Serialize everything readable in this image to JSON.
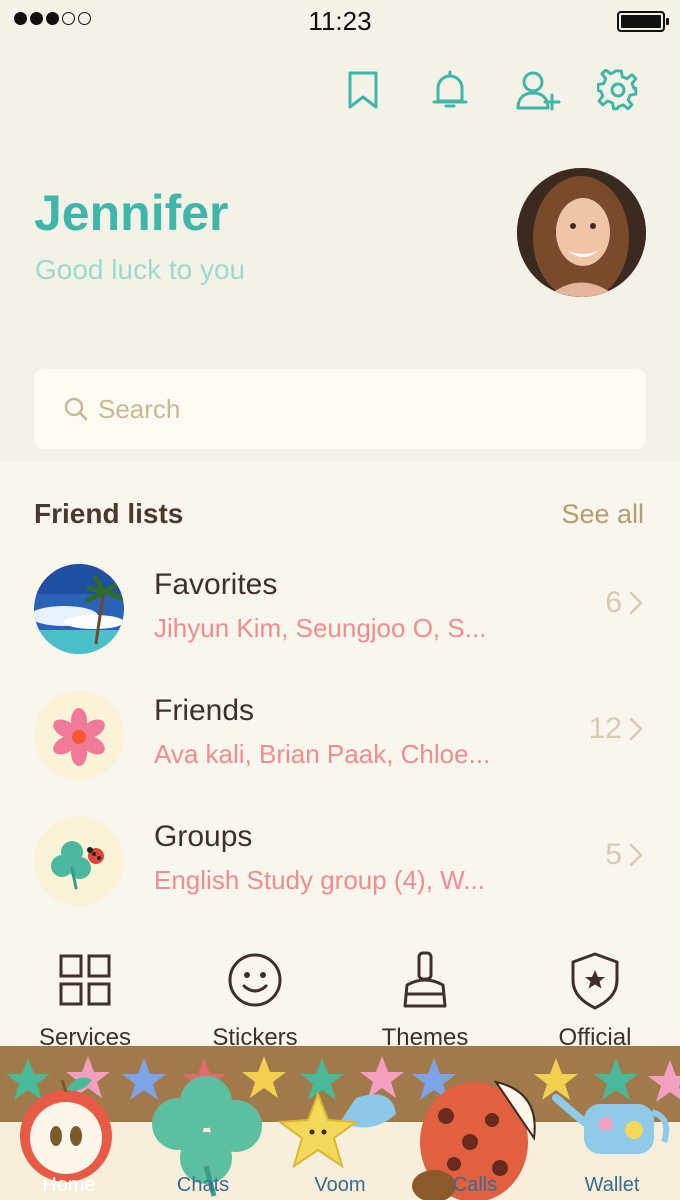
{
  "status_bar": {
    "time": "11:23"
  },
  "top_icons": [
    "bookmark-icon",
    "bell-icon",
    "add-friend-icon",
    "settings-gear-icon"
  ],
  "profile": {
    "name": "Jennifer",
    "status_message": "Good luck to you"
  },
  "search": {
    "placeholder": "Search"
  },
  "friend_lists": {
    "title": "Friend lists",
    "see_all": "See all",
    "items": [
      {
        "title": "Favorites",
        "members": "Jihyun Kim, Seungjoo O, S...",
        "count": "6"
      },
      {
        "title": "Friends",
        "members": "Ava kali, Brian Paak, Chloe...",
        "count": "12"
      },
      {
        "title": "Groups",
        "members": "English Study group (4), W...",
        "count": "5"
      }
    ]
  },
  "services": [
    {
      "label": "Services",
      "icon": "grid-icon"
    },
    {
      "label": "Stickers",
      "icon": "smiley-icon"
    },
    {
      "label": "Themes",
      "icon": "brush-icon"
    },
    {
      "label": "Official",
      "icon": "shield-star-icon"
    }
  ],
  "tabs": [
    {
      "label": "Home",
      "active": true
    },
    {
      "label": "Chats"
    },
    {
      "label": "Voom"
    },
    {
      "label": "Calls"
    },
    {
      "label": "Wallet"
    }
  ],
  "colors": {
    "accent": "#3fb7a8",
    "status_message": "#9ed8cf",
    "members_text": "#f08d8d",
    "see_all": "#b59c70",
    "background": "#f9f6ee"
  }
}
